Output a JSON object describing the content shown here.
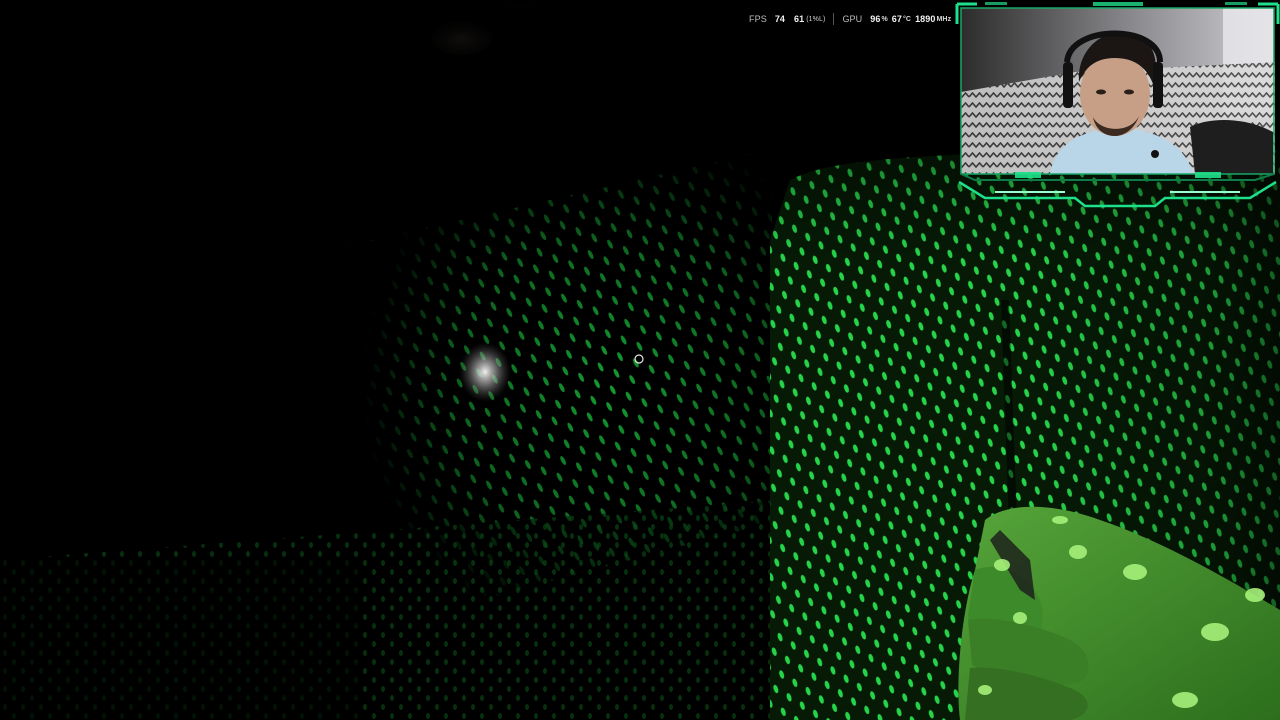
{
  "perf_overlay": {
    "fps_label": "FPS",
    "fps_value": "74",
    "fps_low_value": "61",
    "fps_low_sub": "(1%L)",
    "gpu_label": "GPU",
    "gpu_usage_value": "96",
    "gpu_usage_unit": "%",
    "gpu_temp_value": "67",
    "gpu_temp_unit": "°C",
    "gpu_clock_value": "1890",
    "gpu_clock_unit": "MHz"
  },
  "webcam": {
    "frame_accent_color": "#1fe08a",
    "background_colors": [
      "#2c2c2c",
      "#cfcfd4"
    ]
  },
  "scene": {
    "dot_color": "#19c23a",
    "hand_color": "#3f8a2a"
  }
}
